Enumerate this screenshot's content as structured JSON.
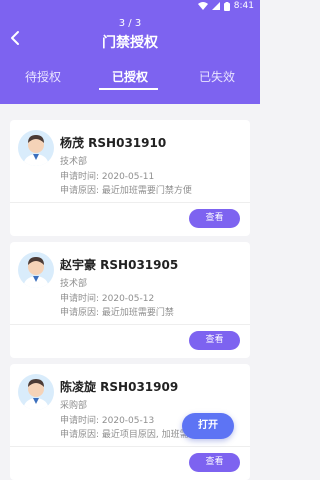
{
  "status_bar": {
    "time": "8:41"
  },
  "header": {
    "counter": "3 / 3",
    "title": "门禁授权"
  },
  "tabs": [
    {
      "label": "待授权",
      "active": false
    },
    {
      "label": "已授权",
      "active": true
    },
    {
      "label": "已失效",
      "active": false
    }
  ],
  "cards": [
    {
      "name": "杨茂 RSH031910",
      "dept": "技术部",
      "time": "申请时间: 2020-05-11",
      "reason": "申请原因: 最近加班需要门禁方便",
      "button": "查看"
    },
    {
      "name": "赵宇豪 RSH031905",
      "dept": "技术部",
      "time": "申请时间: 2020-05-12",
      "reason": "申请原因: 最近加班需要门禁",
      "button": "查看"
    },
    {
      "name": "陈凌旋 RSH031909",
      "dept": "采购部",
      "time": "申请时间: 2020-05-13",
      "reason": "申请原因: 最近项目原因, 加班需",
      "button": "查看"
    }
  ],
  "fab": {
    "label": "打开"
  },
  "colors": {
    "primary": "#7d63f0",
    "fab": "#5d74f4",
    "background": "#f3f3f6"
  }
}
